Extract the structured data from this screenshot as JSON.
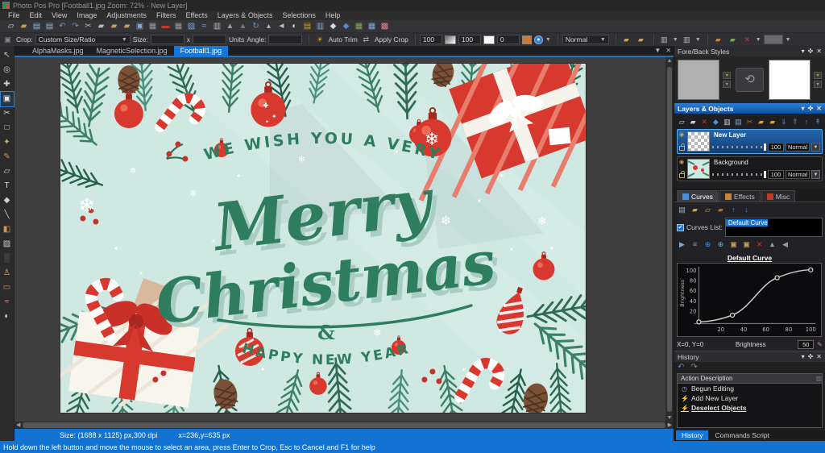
{
  "window": {
    "title": "Photo Pos Pro [Football1.jpg Zoom: 72% - New Layer]"
  },
  "menu": {
    "items": [
      "File",
      "Edit",
      "View",
      "Image",
      "Adjustments",
      "Filters",
      "Effects",
      "Layers & Objects",
      "Selections",
      "Help"
    ]
  },
  "toolbar": {
    "icons": [
      {
        "name": "new-file-icon",
        "glyph": "▱",
        "color": "#d8d8d8"
      },
      {
        "name": "open-folder-icon",
        "glyph": "▰",
        "color": "#caa04a"
      },
      {
        "name": "save-icon",
        "glyph": "▤",
        "color": "#8fb6da"
      },
      {
        "name": "save-all-icon",
        "glyph": "▤",
        "color": "#8fb6da"
      },
      {
        "name": "undo-icon",
        "glyph": "↶",
        "color": "#6f92c9"
      },
      {
        "name": "redo-icon",
        "glyph": "↷",
        "color": "#6f92c9"
      },
      {
        "name": "cut-icon",
        "glyph": "✂",
        "color": "#b9b9b9"
      },
      {
        "name": "copy-icon",
        "glyph": "▰",
        "color": "#b9b9b9"
      },
      {
        "name": "paste-icon",
        "glyph": "▰",
        "color": "#c9a35a"
      },
      {
        "name": "paste-as-new-icon",
        "glyph": "▰",
        "color": "#c9a35a"
      },
      {
        "name": "capture-icon",
        "glyph": "▣",
        "color": "#7fa8d0"
      },
      {
        "name": "fill-tool-icon",
        "glyph": "▦",
        "color": "#9a9a9a"
      },
      {
        "name": "remove-icon",
        "glyph": "▬",
        "color": "#c0392b"
      },
      {
        "name": "image-size-icon",
        "glyph": "▦",
        "color": "#9a9a9a"
      },
      {
        "name": "collage-icon",
        "glyph": "▨",
        "color": "#7fa8d0"
      },
      {
        "name": "curves-shortcut-icon",
        "glyph": "≈",
        "color": "#7fa8d0"
      },
      {
        "name": "text-box-icon",
        "glyph": "▥",
        "color": "#b9b9b9"
      },
      {
        "name": "shear-icon",
        "glyph": "▲",
        "color": "#9a9a9a"
      },
      {
        "name": "perspective-icon",
        "glyph": "▲",
        "color": "#777777"
      },
      {
        "name": "rotate-icon",
        "glyph": "↻",
        "color": "#6f92c9"
      },
      {
        "name": "sharpen-icon",
        "glyph": "▴",
        "color": "#b9b9b9"
      },
      {
        "name": "arrow-left-icon",
        "glyph": "◄",
        "color": "#b9b9b9"
      },
      {
        "name": "contrast-icon",
        "glyph": "◐",
        "color": "#d8d8d8"
      },
      {
        "name": "color-bars-icon",
        "glyph": "▤",
        "color": "#d4a017"
      },
      {
        "name": "columns-icon",
        "glyph": "▥",
        "color": "#7fa8d0"
      },
      {
        "name": "drop-icon",
        "glyph": "◆",
        "color": "#d8d8d8"
      },
      {
        "name": "drop-blue-icon",
        "glyph": "◆",
        "color": "#5b86c5"
      },
      {
        "name": "grid-green-icon",
        "glyph": "▦",
        "color": "#7daa5a"
      },
      {
        "name": "grid-blue-icon",
        "glyph": "▦",
        "color": "#7fa8d0"
      },
      {
        "name": "palette-icon",
        "glyph": "▩",
        "color": "#d08a9a"
      }
    ]
  },
  "options": {
    "crop_label": "Crop:",
    "crop_mode": "Custom Size/Ratio",
    "size_label": "Size:",
    "size_x_value": "",
    "size_sep": "x",
    "size_y_value": "",
    "units_label": "Units",
    "angle_label": "Angle:",
    "angle_value": "",
    "auto_trim_label": "Auto Trim",
    "apply_crop_label": "Apply Crop",
    "value1": "100",
    "value2": "100",
    "value3": "0",
    "blend_mode": "Normal"
  },
  "doc_tabs": {
    "items": [
      {
        "label": "AlphaMasks.jpg",
        "active": false
      },
      {
        "label": "MagneticSelection.jpg",
        "active": false
      },
      {
        "label": "Football1.jpg",
        "active": true
      }
    ]
  },
  "tools": {
    "items": [
      {
        "name": "pointer-tool-icon",
        "glyph": "↖",
        "color": "#cfcfcf",
        "active": false
      },
      {
        "name": "zoom-tool-icon",
        "glyph": "◎",
        "color": "#cfcfcf",
        "active": false
      },
      {
        "name": "move-tool-icon",
        "glyph": "✚",
        "color": "#cfcfcf",
        "active": false
      },
      {
        "name": "crop-tool-icon",
        "glyph": "▣",
        "color": "#e8e8e8",
        "active": true
      },
      {
        "name": "path-cut-tool-icon",
        "glyph": "✂",
        "color": "#cfcfcf",
        "active": false
      },
      {
        "name": "select-rect-tool-icon",
        "glyph": "□",
        "color": "#cfcfcf",
        "active": false
      },
      {
        "name": "magic-wand-tool-icon",
        "glyph": "✦",
        "color": "#d8b25a",
        "active": false
      },
      {
        "name": "brush-tool-icon",
        "glyph": "✎",
        "color": "#d8955a",
        "active": false
      },
      {
        "name": "clone-tool-icon",
        "glyph": "▱",
        "color": "#cfcfcf",
        "active": false
      },
      {
        "name": "text-tool-icon",
        "glyph": "T",
        "color": "#e0e0e0",
        "active": false
      },
      {
        "name": "shape-tool-icon",
        "glyph": "◆",
        "color": "#cfcfcf",
        "active": false
      },
      {
        "name": "line-tool-icon",
        "glyph": "╲",
        "color": "#cfcfcf",
        "active": false
      },
      {
        "name": "fill-bucket-tool-icon",
        "glyph": "◧",
        "color": "#d8955a",
        "active": false
      },
      {
        "name": "gradient-tool-icon",
        "glyph": "▨",
        "color": "#cfcfcf",
        "active": false
      },
      {
        "name": "airbrush-tool-icon",
        "glyph": "░",
        "color": "#9ab0d0",
        "active": false
      },
      {
        "name": "stamp-tool-icon",
        "glyph": "♙",
        "color": "#d8b25a",
        "active": false
      },
      {
        "name": "eraser-tool-icon",
        "glyph": "▭",
        "color": "#d8955a",
        "active": false
      },
      {
        "name": "smudge-tool-icon",
        "glyph": "≈",
        "color": "#d08a9a",
        "active": false
      },
      {
        "name": "dodge-burn-tool-icon",
        "glyph": "◐",
        "color": "#e8e8e8",
        "active": false
      }
    ]
  },
  "card": {
    "line1": "WE WISH YOU A VERY",
    "script1": "Merry",
    "script2": "Christmas",
    "amp": "&",
    "line4": "HAPPY NEW YEAR",
    "bg": "#cfe8e2",
    "green": "#2e7d5f",
    "red": "#d8392e"
  },
  "status_bar": {
    "size_text": "Size: (1688 x 1125) px,300 dpi",
    "coords_text": "x=236,y=635 px"
  },
  "panels": {
    "fore_back": {
      "title": "Fore/Back Styles",
      "fore_color": "#b0b0b0",
      "back_color": "#ffffff"
    },
    "layers": {
      "title": "Layers & Objects",
      "toolbar_icons": [
        {
          "name": "new-layer-icon",
          "glyph": "▱",
          "color": "#d8d8d8"
        },
        {
          "name": "duplicate-layer-icon",
          "glyph": "▰",
          "color": "#cfcfcf"
        },
        {
          "name": "delete-layer-icon",
          "glyph": "✕",
          "color": "#c0392b"
        },
        {
          "name": "layer-mask-icon",
          "glyph": "◆",
          "color": "#4a90d9"
        },
        {
          "name": "copy-layer-icon",
          "glyph": "▥",
          "color": "#cfcfcf"
        },
        {
          "name": "merge-layer-icon",
          "glyph": "▤",
          "color": "#7fa8d0"
        },
        {
          "name": "cut-layer-icon",
          "glyph": "✂",
          "color": "#b06a2a"
        },
        {
          "name": "group-layers-icon",
          "glyph": "▰",
          "color": "#caa04a"
        },
        {
          "name": "paste-layer-icon",
          "glyph": "▰",
          "color": "#caa04a"
        },
        {
          "name": "move-layer-down-icon",
          "glyph": "⇓",
          "color": "#4a90d9"
        },
        {
          "name": "move-layer-up-icon",
          "glyph": "⇑",
          "color": "#4a90d9"
        },
        {
          "name": "bring-front-icon",
          "glyph": "↑",
          "color": "#4a90d9"
        },
        {
          "name": "send-back-icon",
          "glyph": "↟",
          "color": "#4a90d9"
        }
      ],
      "items": [
        {
          "name": "New Layer",
          "opacity": "100",
          "blend": "Normal",
          "selected": true
        },
        {
          "name": "Background",
          "opacity": "100",
          "blend": "Normal",
          "selected": false
        }
      ]
    },
    "adj_tabs": {
      "items": [
        {
          "label": "Curves",
          "active": true,
          "color": "#4a90d9"
        },
        {
          "label": "Effects",
          "active": false,
          "color": "#c9833a"
        },
        {
          "label": "Misc",
          "active": false,
          "color": "#c0392b"
        }
      ]
    },
    "curves": {
      "toolbar1": [
        {
          "name": "save-curve-icon",
          "glyph": "▤",
          "color": "#8fb6da"
        },
        {
          "name": "load-curve-icon",
          "glyph": "▰",
          "color": "#caa04a"
        },
        {
          "name": "new-curve-icon",
          "glyph": "▱",
          "color": "#caa04a"
        },
        {
          "name": "copy-curve-icon",
          "glyph": "▰",
          "color": "#b06a2a"
        },
        {
          "name": "curve-up-icon",
          "glyph": "↑",
          "color": "#4a90d9"
        },
        {
          "name": "curve-down-icon",
          "glyph": "↓",
          "color": "#4a90d9"
        }
      ],
      "toolbar2": [
        {
          "name": "apply-curve-icon",
          "glyph": "▶",
          "color": "#7fa8d0"
        },
        {
          "name": "curve-presets-icon",
          "glyph": "≡",
          "color": "#9a9a9a"
        },
        {
          "name": "add-point-icon",
          "glyph": "⊕",
          "color": "#4a90d9"
        },
        {
          "name": "remove-point-icon",
          "glyph": "⊕",
          "color": "#76a8d8"
        },
        {
          "name": "input-range-icon",
          "glyph": "▣",
          "color": "#c9a35a"
        },
        {
          "name": "output-range-icon",
          "glyph": "▣",
          "color": "#c9a35a"
        },
        {
          "name": "delete-curve-icon",
          "glyph": "✕",
          "color": "#c0392b"
        },
        {
          "name": "invert-curve-icon",
          "glyph": "▲",
          "color": "#9a9a9a"
        },
        {
          "name": "reset-curve-icon",
          "glyph": "◀",
          "color": "#9a9a9a"
        }
      ],
      "list_label": "Curves List:",
      "selected_item": "Default Curve",
      "graph_title": "Default Curve",
      "axis_label_x": "Brightness",
      "axis_label_y": "Brightness",
      "xticks": [
        "20",
        "40",
        "60",
        "80",
        "100"
      ],
      "yticks": [
        "100",
        "80",
        "60",
        "40",
        "20"
      ],
      "points": [
        [
          0,
          0
        ],
        [
          30,
          13
        ],
        [
          70,
          85
        ],
        [
          100,
          100
        ]
      ],
      "coords_label": "X=0, Y=0",
      "value": "50"
    },
    "history": {
      "title": "History",
      "column_header": "Action Description",
      "items": [
        {
          "icon": "clock-icon",
          "glyph": "◷",
          "color": "#9ab0d0",
          "label": "Begun Editing",
          "current": false
        },
        {
          "icon": "action-bolt-icon",
          "glyph": "⚡",
          "color": "#d8b25a",
          "label": "Add New Layer",
          "current": false
        },
        {
          "icon": "action-bolt-icon",
          "glyph": "⚡",
          "color": "#d8b25a",
          "label": "Deselect Objects",
          "current": true
        }
      ],
      "bottom_tabs": [
        {
          "label": "History",
          "active": true
        },
        {
          "label": "Commands Script",
          "active": false
        }
      ]
    }
  },
  "hint_bar": {
    "text": "Hold down the left button and move the mouse to select an area, press Enter to Crop, Esc to Cancel and F1 for help"
  }
}
